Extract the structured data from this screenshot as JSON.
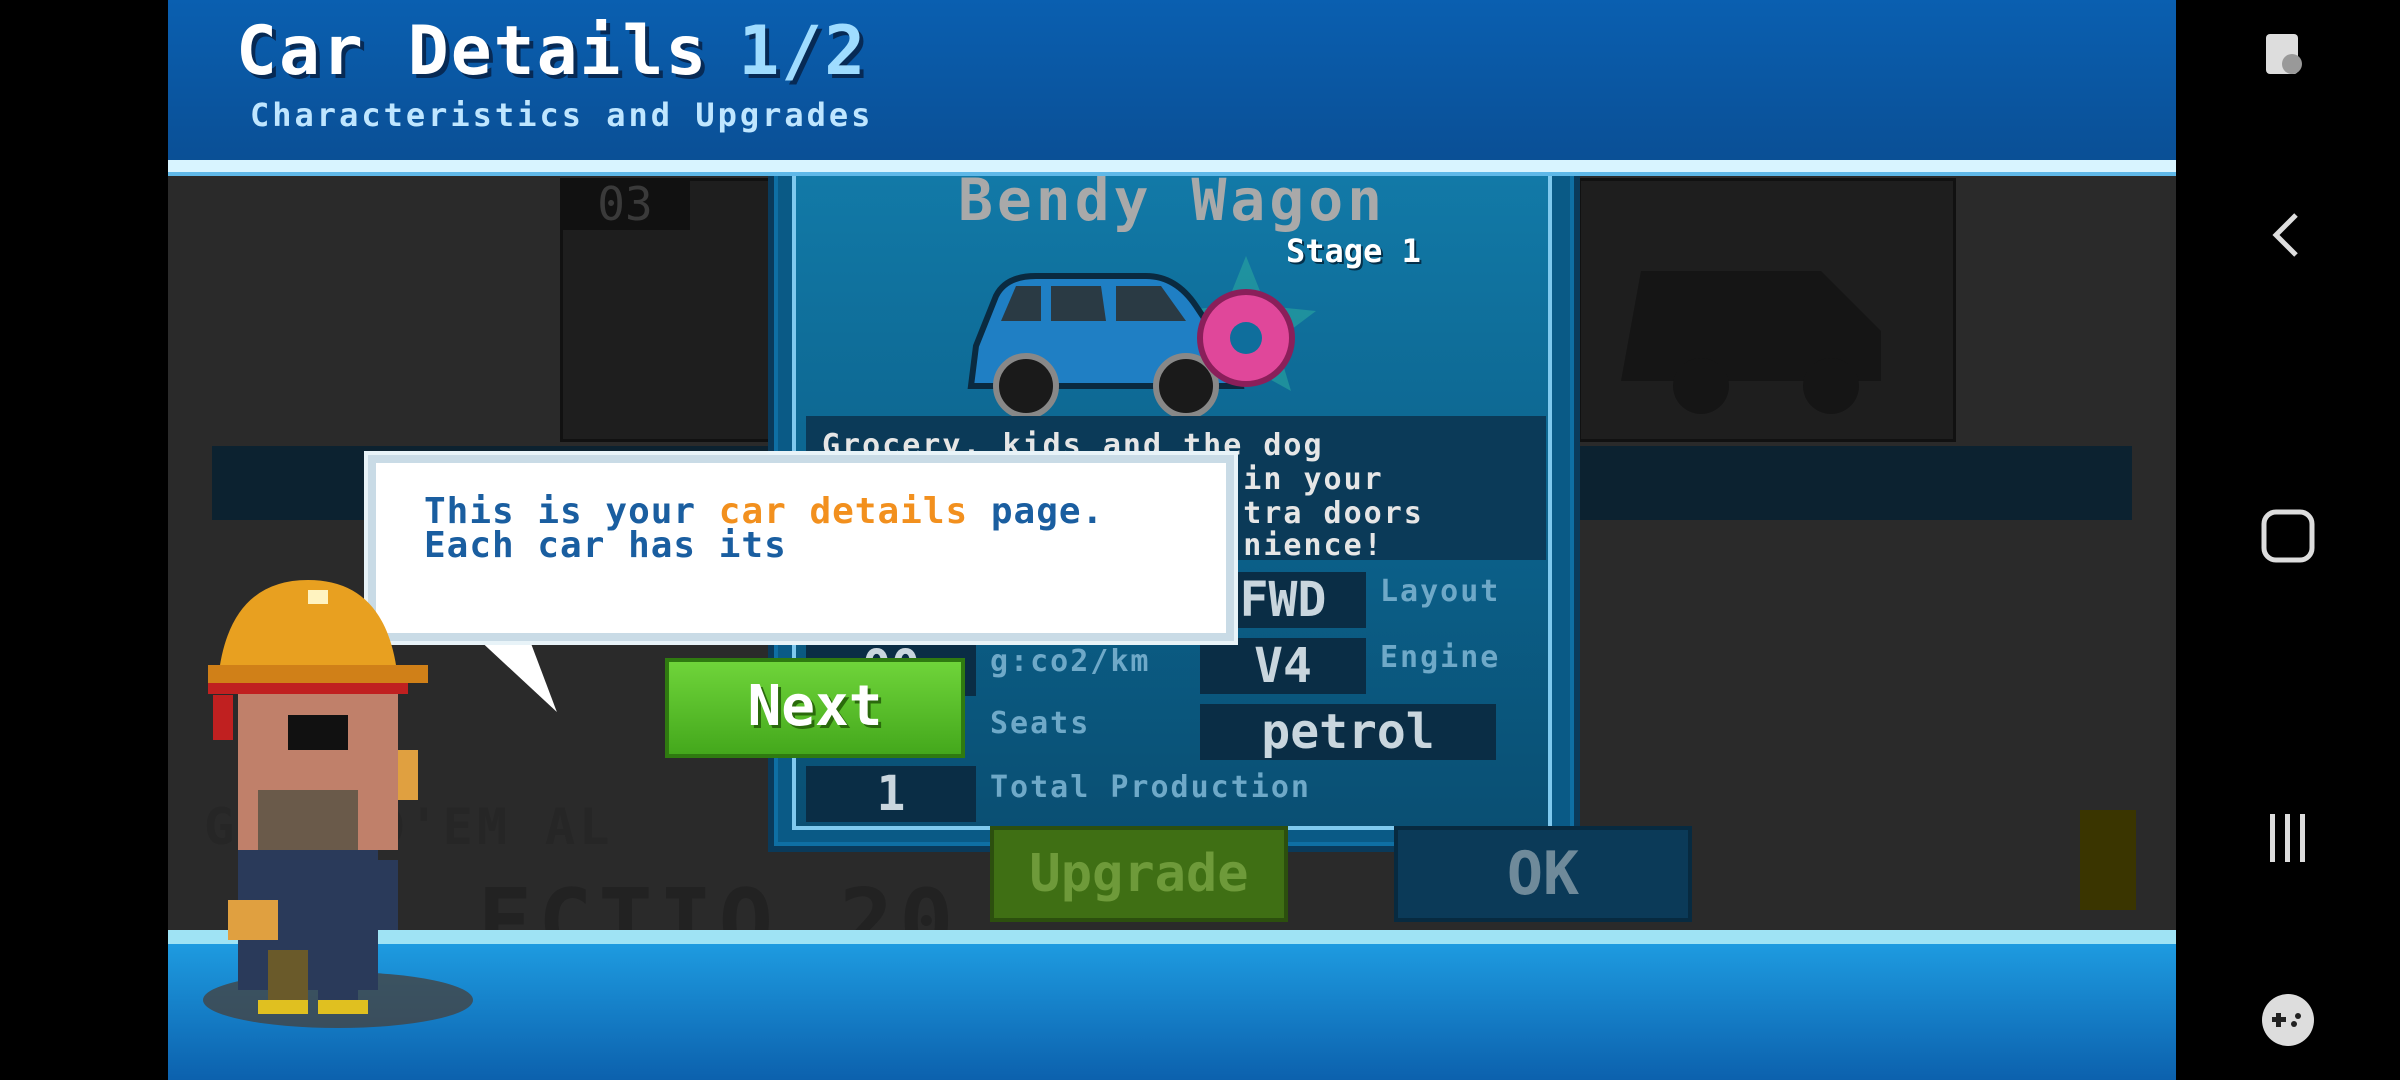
{
  "header": {
    "title": "Car Details",
    "page": "1/2",
    "subtitle": "Characteristics and Upgrades"
  },
  "background": {
    "card_number": "03",
    "banner_fragment": "GO  ILD'EM AL",
    "banner_fragment2": "ECTIO   20"
  },
  "car": {
    "name": "Bendy Wagon",
    "stage": "Stage 1",
    "description_lines": [
      "Grocery, kids and the dog",
      "                     in your",
      "                     tra doors",
      "                     nience!"
    ],
    "stats": {
      "co2_value": "00",
      "co2_label": "g:co2/km",
      "seats_label": "Seats",
      "production_value": "1",
      "production_label": "Total Production",
      "layout_value": "FWD",
      "layout_label": "Layout",
      "engine_value": "V4",
      "engine_label": "Engine",
      "fuel_value": "petrol"
    },
    "colors": {
      "body": "#1f7fc4",
      "donut": "#e0479a",
      "star": "#2aa7a0"
    }
  },
  "buttons": {
    "upgrade": "Upgrade",
    "ok": "OK",
    "next": "Next"
  },
  "tutorial": {
    "line1_pre": "This is your ",
    "line1_highlight": "car details",
    "line1_post": " page.",
    "line2": "Each car has its"
  },
  "navbar": {
    "icons": [
      "screen-touch-icon",
      "back-icon",
      "home-icon",
      "recents-icon",
      "game-tools-icon"
    ]
  }
}
